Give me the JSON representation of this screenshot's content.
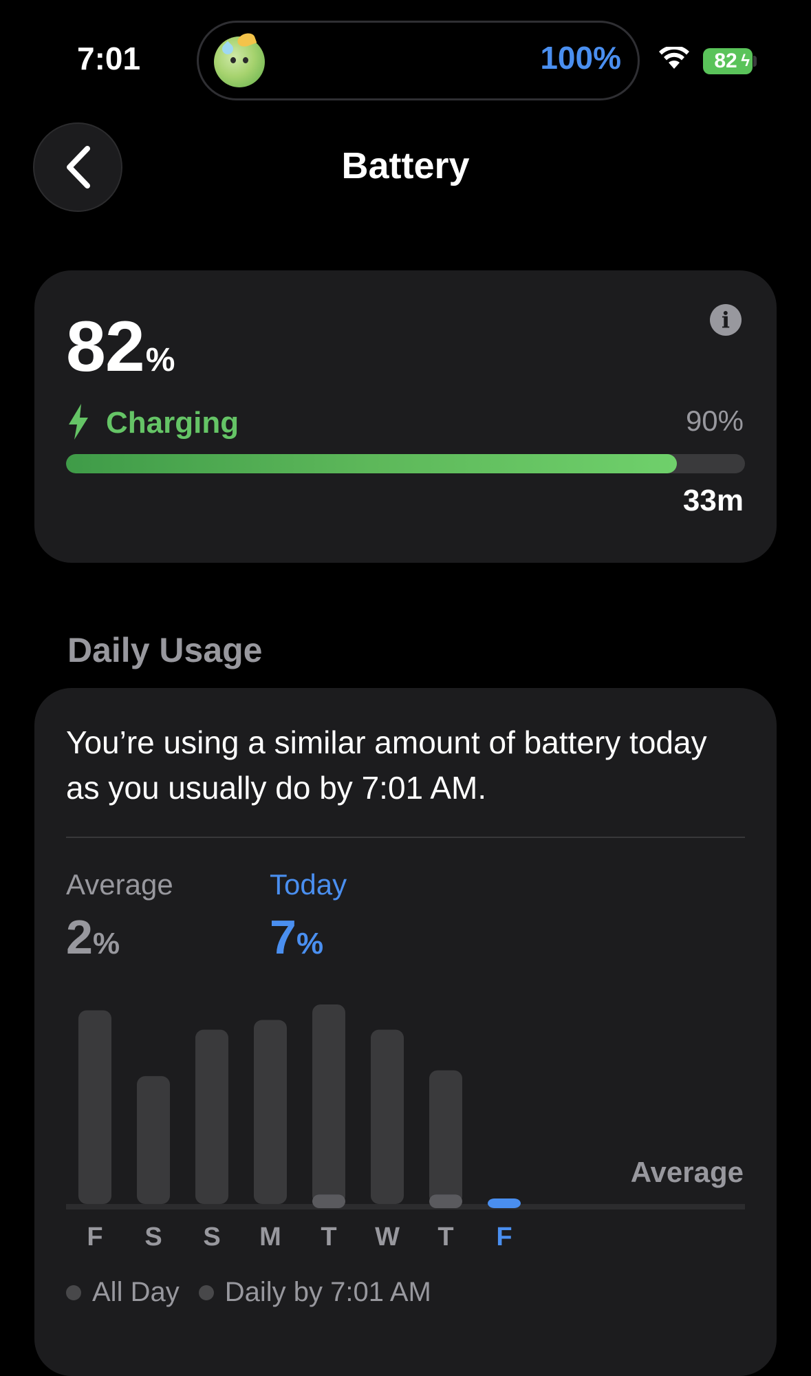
{
  "status_bar": {
    "time": "7:01",
    "island_percent": "100%",
    "battery_level": "82"
  },
  "nav": {
    "title": "Battery",
    "back_icon": "chevron-left-icon"
  },
  "battery_card": {
    "level": "82",
    "level_unit": "%",
    "status": "Charging",
    "charge_limit": "90%",
    "time_remaining": "33m",
    "progress_fraction": 0.9,
    "colors": {
      "accent_green": "#65c466",
      "blue": "#4a8ff0"
    }
  },
  "daily_usage": {
    "section_title": "Daily Usage",
    "summary": "You’re using a similar amount of battery today as you usually do by 7:01 AM.",
    "average_label": "Average",
    "average_value": "2",
    "today_label": "Today",
    "today_value": "7",
    "percent_sign": "%",
    "chart_average_label": "Average",
    "legend": [
      "All Day",
      "Daily by 7:01 AM"
    ]
  },
  "chart_data": {
    "type": "bar",
    "categories": [
      "F",
      "S",
      "S",
      "M",
      "T",
      "W",
      "T",
      "F"
    ],
    "series": [
      {
        "name": "All Day",
        "values": [
          100,
          66,
          90,
          95,
          103,
          90,
          69,
          0
        ]
      },
      {
        "name": "Daily by 7:01 AM",
        "values": [
          0,
          0,
          0,
          0,
          7,
          0,
          7,
          3
        ]
      }
    ],
    "highlight_index": 7,
    "grid": false
  }
}
